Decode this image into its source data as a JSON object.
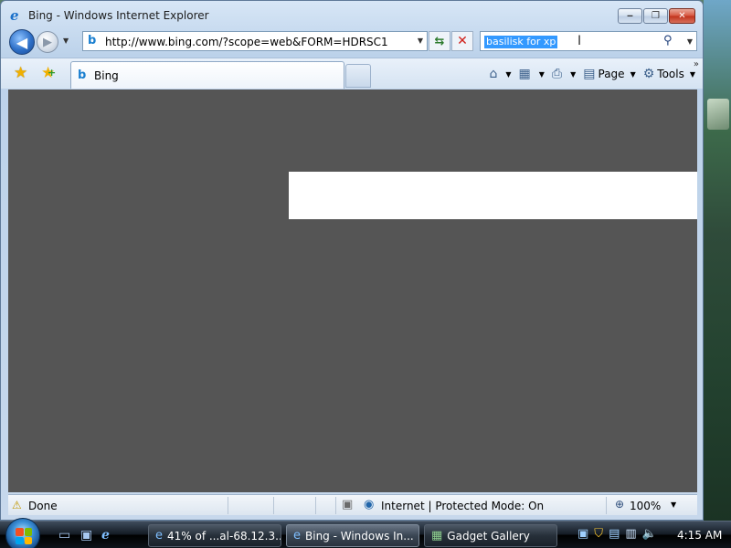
{
  "window": {
    "title": "Bing - Windows Internet Explorer",
    "buttons": {
      "minimize": "‒",
      "maximize": "❐",
      "close": "✕"
    }
  },
  "nav": {
    "back_icon": "back-arrow-icon",
    "forward_icon": "forward-arrow-icon",
    "address_url": "http://www.bing.com/?scope=web&FORM=HDRSC1",
    "search_query": "basilisk for xp"
  },
  "tabs": [
    {
      "label": "Bing",
      "active": true
    }
  ],
  "commands": {
    "home": "",
    "feeds": "",
    "print": "",
    "page": "Page",
    "tools": "Tools"
  },
  "status": {
    "text": "Done",
    "zone": "Internet | Protected Mode: On",
    "zoom": "100%"
  },
  "taskbar": {
    "tasks": [
      {
        "label": "41% of ...al-68.12.3...",
        "active": false
      },
      {
        "label": "Bing - Windows In...",
        "active": true
      },
      {
        "label": "Gadget Gallery",
        "active": false
      }
    ],
    "clock": "4:15 AM"
  },
  "colors": {
    "content_bg": "#555555",
    "content_panel": "#ffffff",
    "selection": "#3399ff"
  }
}
